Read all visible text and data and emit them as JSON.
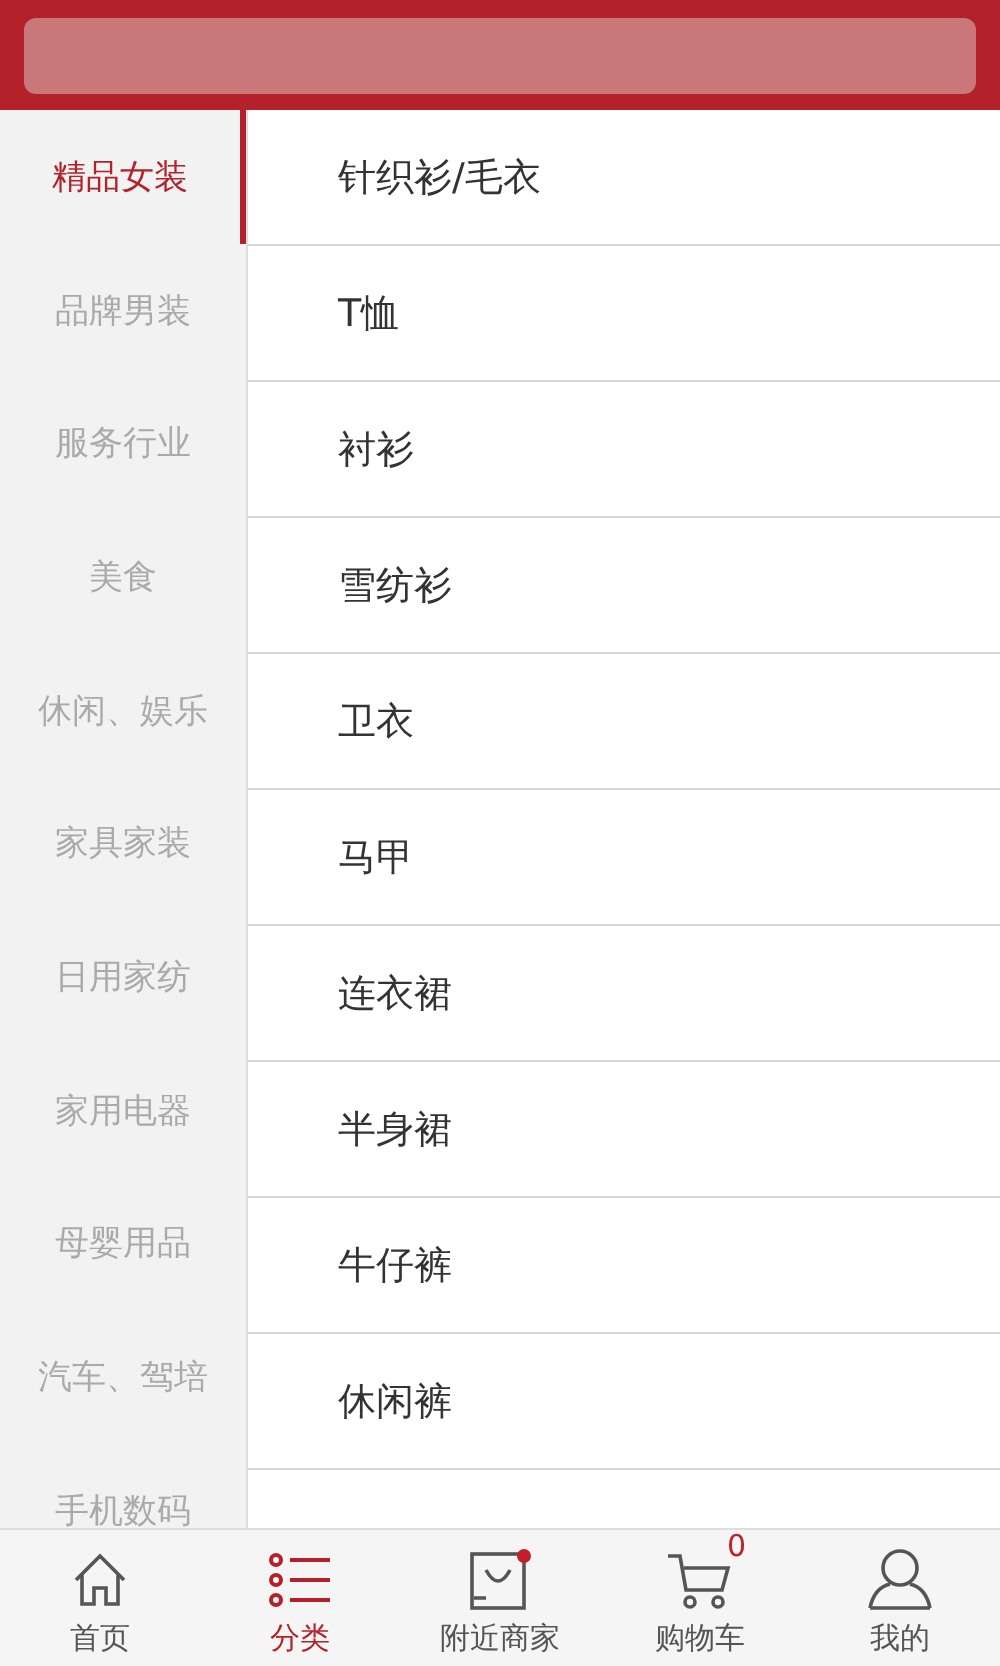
{
  "sidebar": {
    "items": [
      {
        "label": "精品女装",
        "selected": true
      },
      {
        "label": "品牌男装",
        "selected": false
      },
      {
        "label": "服务行业",
        "selected": false
      },
      {
        "label": "美食",
        "selected": false
      },
      {
        "label": "休闲、娱乐",
        "selected": false
      },
      {
        "label": "家具家装",
        "selected": false
      },
      {
        "label": "日用家纺",
        "selected": false
      },
      {
        "label": "家用电器",
        "selected": false
      },
      {
        "label": "母婴用品",
        "selected": false
      },
      {
        "label": "汽车、驾培",
        "selected": false
      },
      {
        "label": "手机数码",
        "selected": false
      }
    ]
  },
  "subcategories": [
    "针织衫/毛衣",
    "T恤",
    "衬衫",
    "雪纺衫",
    "卫衣",
    "马甲",
    "连衣裙",
    "半身裙",
    "牛仔裤",
    "休闲裤"
  ],
  "tab_bar": [
    {
      "kind": "home",
      "label": "首页",
      "selected": false
    },
    {
      "kind": "category",
      "label": "分类",
      "selected": true
    },
    {
      "kind": "store",
      "label": "附近商家",
      "selected": false,
      "dot": true
    },
    {
      "kind": "cart",
      "label": "购物车",
      "selected": false,
      "count": "0"
    },
    {
      "kind": "user",
      "label": "我的",
      "selected": false
    }
  ]
}
